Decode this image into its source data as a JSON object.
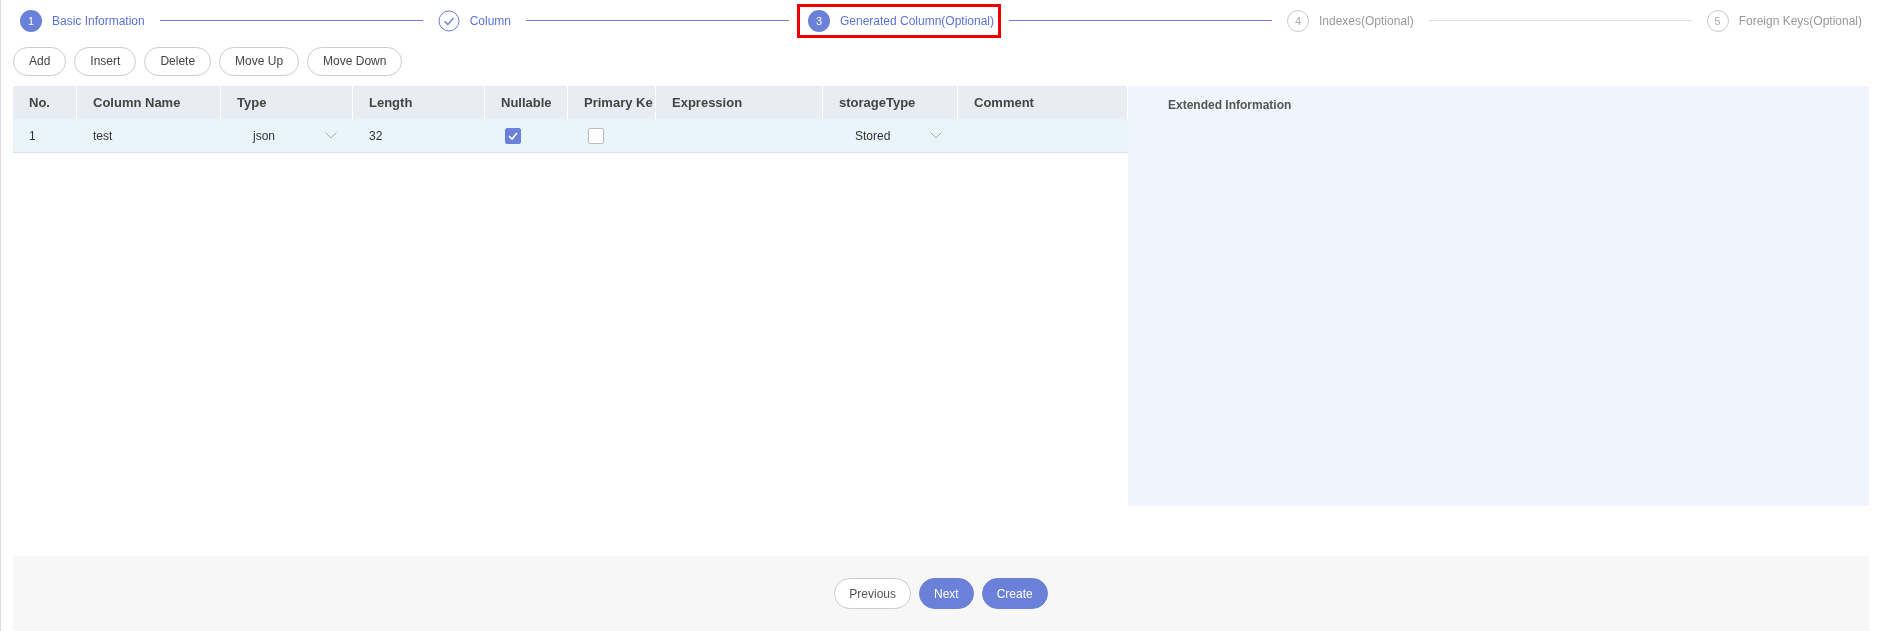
{
  "steps": [
    {
      "number": "1",
      "title": "Basic Information",
      "kind": "active",
      "highlighted": false
    },
    {
      "title": "Column",
      "kind": "done",
      "highlighted": false
    },
    {
      "number": "3",
      "title": "Generated Column(Optional)",
      "kind": "active",
      "highlighted": true
    },
    {
      "number": "4",
      "title": "Indexes(Optional)",
      "kind": "wait",
      "highlighted": false
    },
    {
      "number": "5",
      "title": "Foreign Keys(Optional)",
      "kind": "wait",
      "highlighted": false
    }
  ],
  "toolbar": [
    "Add",
    "Insert",
    "Delete",
    "Move Up",
    "Move Down"
  ],
  "table": {
    "columns": [
      "No.",
      "Column Name",
      "Type",
      "Length",
      "Nullable",
      "Primary Ke",
      "Expression",
      "storageType",
      "Comment"
    ],
    "rows": [
      {
        "selected": true,
        "cells": [
          {
            "kind": "text",
            "value": "1"
          },
          {
            "kind": "text",
            "value": "test"
          },
          {
            "kind": "select",
            "value": "json"
          },
          {
            "kind": "text",
            "value": "32"
          },
          {
            "kind": "checkbox",
            "checked": true
          },
          {
            "kind": "checkbox",
            "checked": false
          },
          {
            "kind": "empty"
          },
          {
            "kind": "select",
            "value": "Stored"
          },
          {
            "kind": "empty"
          }
        ]
      }
    ]
  },
  "extended_panel": {
    "title": "Extended Information"
  },
  "footer": [
    {
      "label": "Previous",
      "primary": false
    },
    {
      "label": "Next",
      "primary": true
    },
    {
      "label": "Create",
      "primary": true
    }
  ]
}
